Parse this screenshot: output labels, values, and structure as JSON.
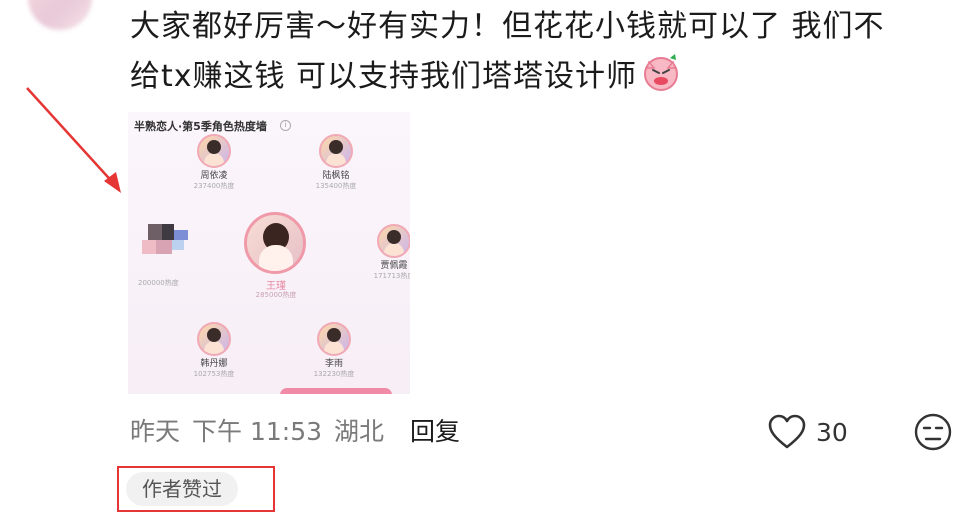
{
  "comment": {
    "line1": "大家都好厉害～好有实力！但花花小钱就可以了 我们不",
    "line2": "给tx赚这钱 可以支持我们塔塔设计师",
    "emoji_icon": "angry-pig-emoji-icon"
  },
  "image": {
    "title": "半熟恋人·第5季角色热度墙",
    "info_icon": "i",
    "nodes": [
      {
        "name": "周依凌",
        "heat": "237400热度"
      },
      {
        "name": "陆枫铭",
        "heat": "135400热度"
      },
      {
        "name": "贾佩霞",
        "heat": "171713热度"
      },
      {
        "name": "韩丹娜",
        "heat": "102753热度"
      },
      {
        "name": "李雨",
        "heat": "132230热度"
      }
    ],
    "center": {
      "name": "王瑾",
      "heat": "285000热度"
    },
    "mosaic_heat": "200000热度"
  },
  "meta": {
    "date": "昨天",
    "time": "下午 11:53",
    "location": "湖北",
    "reply_label": "回复"
  },
  "actions": {
    "like_count": "30",
    "like_icon": "heart-outline-icon",
    "dislike_icon": "grumpy-face-icon"
  },
  "badge": {
    "label": "作者赞过"
  },
  "colors": {
    "highlight_red": "#e53535",
    "badge_bg": "#f1f1f1",
    "meta_gray": "#7a7a7a"
  }
}
